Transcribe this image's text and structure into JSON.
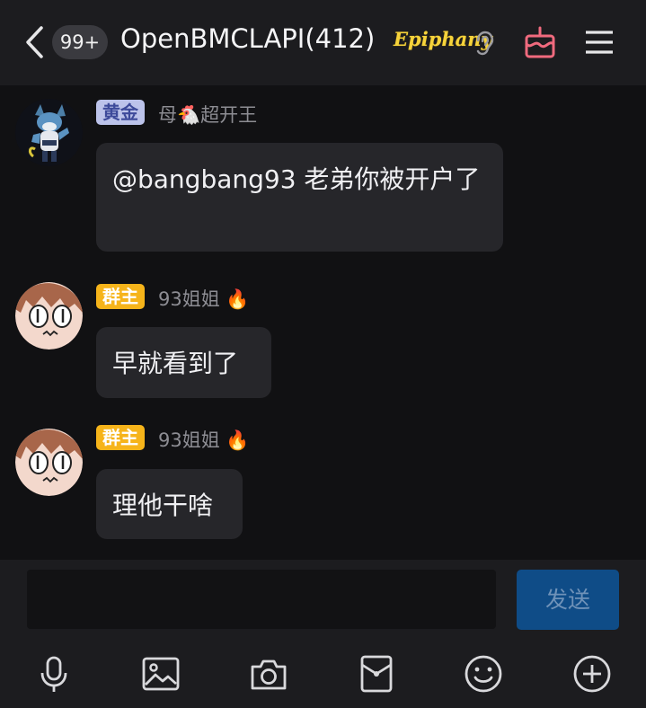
{
  "header": {
    "unread_count": "99+",
    "title": "OpenBMCLAPI(412)",
    "tag": "Epiphany"
  },
  "messages": [
    {
      "role": "黄金",
      "nickname": "母🐔超开王",
      "text": "@bangbang93 老弟你被开户了"
    },
    {
      "role": "群主",
      "nickname": "93姐姐 🔥",
      "text": "早就看到了"
    },
    {
      "role": "群主",
      "nickname": "93姐姐 🔥",
      "text": "理他干啥"
    }
  ],
  "input": {
    "value": "",
    "placeholder": "",
    "send_label": "发送"
  },
  "toolbar": [
    "microphone-icon",
    "image-icon",
    "camera-icon",
    "red-packet-icon",
    "emoji-icon",
    "plus-icon"
  ],
  "colors": {
    "background": "#111113",
    "header": "#1c1c1f",
    "bubble": "#26262a",
    "send_button": "#0f4c87",
    "owner_badge": "#f6b41a",
    "gold_badge": "#bcc3ea",
    "cake_icon": "#f06a7e"
  }
}
